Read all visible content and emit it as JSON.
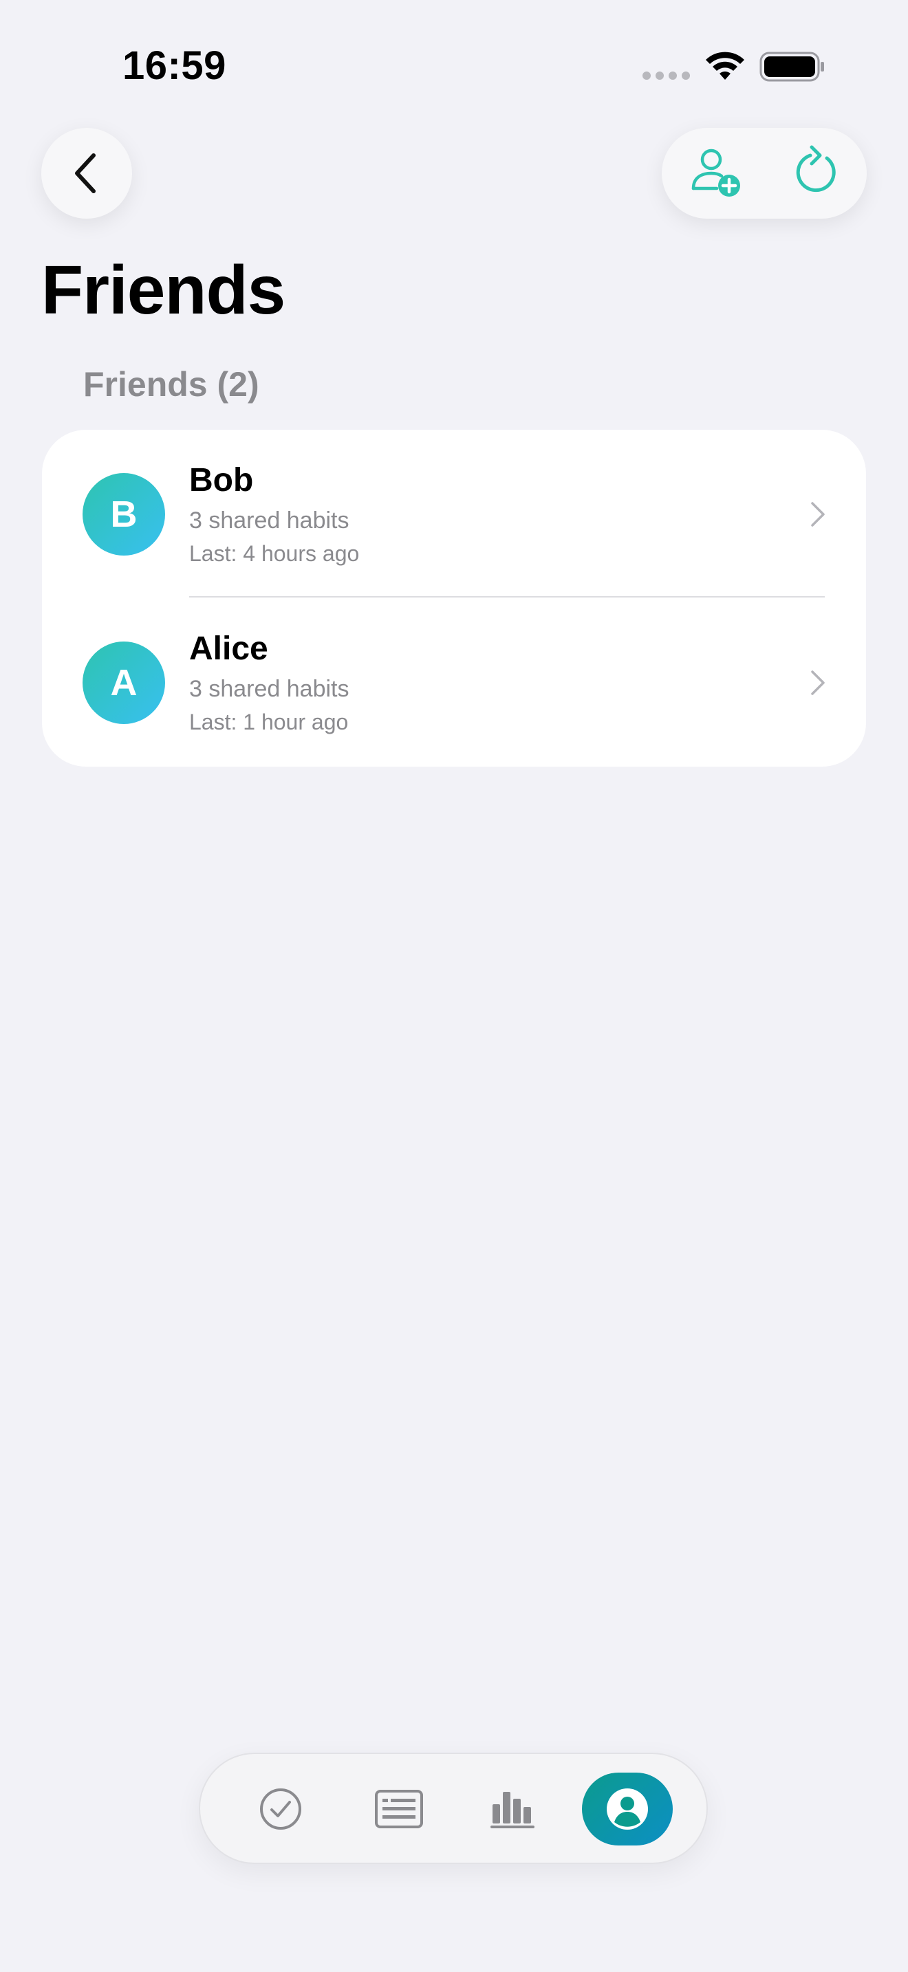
{
  "status_bar": {
    "time": "16:59",
    "wifi_icon": "wifi-icon",
    "battery_icon": "battery-icon"
  },
  "header": {
    "back_icon": "chevron-left-icon",
    "add_friend_icon": "person-add-icon",
    "refresh_icon": "refresh-icon",
    "accent_color": "#2ec4b0"
  },
  "page": {
    "title": "Friends",
    "section_header": "Friends (2)"
  },
  "friends": [
    {
      "initial": "B",
      "name": "Bob",
      "shared_habits": "3 shared habits",
      "last_active": "Last: 4 hours ago"
    },
    {
      "initial": "A",
      "name": "Alice",
      "shared_habits": "3 shared habits",
      "last_active": "Last: 1 hour ago"
    }
  ],
  "tab_bar": {
    "tabs": [
      {
        "icon": "checkmark-circle-icon",
        "active": false
      },
      {
        "icon": "list-icon",
        "active": false
      },
      {
        "icon": "bar-chart-icon",
        "active": false
      },
      {
        "icon": "profile-icon",
        "active": true
      }
    ],
    "active_color": "#0b9b8e"
  }
}
